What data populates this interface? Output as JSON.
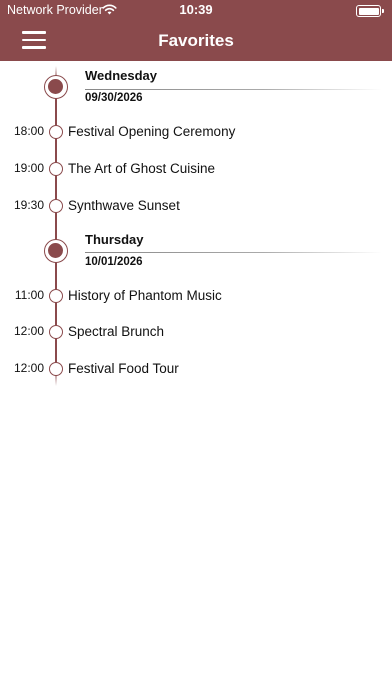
{
  "status": {
    "carrier": "Network Provider",
    "time": "10:39"
  },
  "nav": {
    "title": "Favorites"
  },
  "days": [
    {
      "name": "Wednesday",
      "date": "09/30/2026",
      "events": [
        {
          "time": "18:00",
          "title": "Festival Opening Ceremony"
        },
        {
          "time": "19:00",
          "title": "The Art of Ghost Cuisine"
        },
        {
          "time": "19:30",
          "title": "Synthwave Sunset"
        }
      ]
    },
    {
      "name": "Thursday",
      "date": "10/01/2026",
      "events": [
        {
          "time": "11:00",
          "title": "History of Phantom Music"
        },
        {
          "time": "12:00",
          "title": "Spectral Brunch"
        },
        {
          "time": "12:00",
          "title": "Festival Food Tour"
        }
      ]
    }
  ],
  "colors": {
    "accent": "#8a4a4c",
    "background": "#ffffff"
  }
}
